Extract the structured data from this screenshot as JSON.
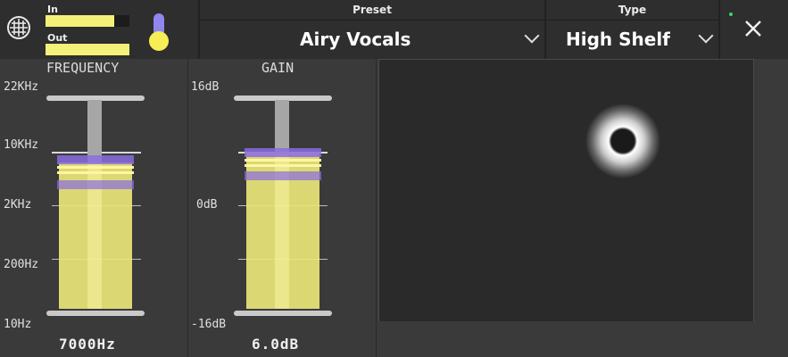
{
  "meters": {
    "in_label": "In",
    "out_label": "Out",
    "in_level": 0.82,
    "out_level": 1.0
  },
  "preset": {
    "title": "Preset",
    "value": "Airy Vocals"
  },
  "type": {
    "title": "Type",
    "value": "High Shelf"
  },
  "frequency": {
    "title": "FREQUENCY",
    "scale": [
      "22KHz",
      "10KHz",
      "2KHz",
      "200Hz",
      "10Hz"
    ],
    "value": "7000Hz"
  },
  "gain": {
    "title": "GAIN",
    "scale": [
      "16dB",
      "0dB",
      "-16dB"
    ],
    "value": "6.0dB"
  },
  "colors": {
    "accent_yellow": "#f4f07a",
    "band_purple": "#8a6ce0",
    "knob_purple": "#8f86f0",
    "knob_yellow": "#f5ef55"
  },
  "icons": {
    "menu": "grid-globe-icon",
    "close": "close-icon",
    "chevron": "chevron-down-icon"
  }
}
